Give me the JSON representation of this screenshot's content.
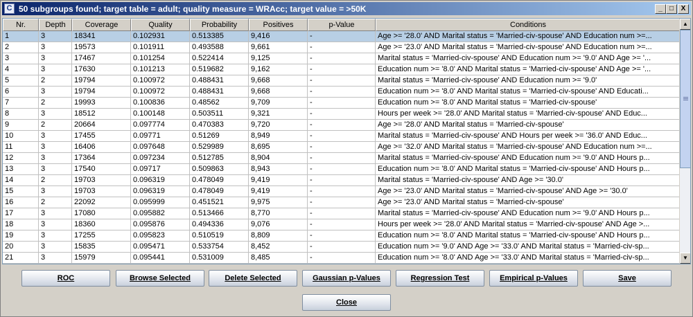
{
  "window": {
    "title": "50 subgroups found;  target table = adult;  quality measure = WRAcc;  target value = >50K",
    "icon_letter": "C",
    "minimize_label": "_",
    "maximize_label": "□",
    "close_label": "X"
  },
  "table": {
    "columns": [
      "Nr.",
      "Depth",
      "Coverage",
      "Quality",
      "Probability",
      "Positives",
      "p-Value",
      "Conditions"
    ],
    "rows": [
      [
        "1",
        "3",
        "18341",
        "0.102931",
        "0.513385",
        "9,416",
        "-",
        "Age >= '28.0' AND Marital status = 'Married-civ-spouse' AND Education num >=..."
      ],
      [
        "2",
        "3",
        "19573",
        "0.101911",
        "0.493588",
        "9,661",
        "-",
        "Age >= '23.0' AND Marital status = 'Married-civ-spouse' AND Education num >=..."
      ],
      [
        "3",
        "3",
        "17467",
        "0.101254",
        "0.522414",
        "9,125",
        "-",
        "Marital status = 'Married-civ-spouse' AND Education num >= '9.0' AND Age >= '..."
      ],
      [
        "4",
        "3",
        "17630",
        "0.101213",
        "0.519682",
        "9,162",
        "-",
        "Education num >= '8.0' AND Marital status = 'Married-civ-spouse' AND Age >= '..."
      ],
      [
        "5",
        "2",
        "19794",
        "0.100972",
        "0.488431",
        "9,668",
        "-",
        "Marital status = 'Married-civ-spouse' AND Education num >= '9.0'"
      ],
      [
        "6",
        "3",
        "19794",
        "0.100972",
        "0.488431",
        "9,668",
        "-",
        "Education num >= '8.0' AND Marital status = 'Married-civ-spouse' AND Educati..."
      ],
      [
        "7",
        "2",
        "19993",
        "0.100836",
        "0.48562",
        "9,709",
        "-",
        "Education num >= '8.0' AND Marital status = 'Married-civ-spouse'"
      ],
      [
        "8",
        "3",
        "18512",
        "0.100148",
        "0.503511",
        "9,321",
        "-",
        "Hours per week >= '28.0' AND Marital status = 'Married-civ-spouse' AND Educ..."
      ],
      [
        "9",
        "2",
        "20664",
        "0.097774",
        "0.470383",
        "9,720",
        "-",
        "Age >= '28.0' AND Marital status = 'Married-civ-spouse'"
      ],
      [
        "10",
        "3",
        "17455",
        "0.09771",
        "0.51269",
        "8,949",
        "-",
        "Marital status = 'Married-civ-spouse' AND Hours per week >= '36.0' AND Educ..."
      ],
      [
        "11",
        "3",
        "16406",
        "0.097648",
        "0.529989",
        "8,695",
        "-",
        "Age >= '32.0' AND Marital status = 'Married-civ-spouse' AND Education num >=..."
      ],
      [
        "12",
        "3",
        "17364",
        "0.097234",
        "0.512785",
        "8,904",
        "-",
        "Marital status = 'Married-civ-spouse' AND Education num >= '9.0' AND Hours p..."
      ],
      [
        "13",
        "3",
        "17540",
        "0.09717",
        "0.509863",
        "8,943",
        "-",
        "Education num >= '8.0' AND Marital status = 'Married-civ-spouse' AND Hours p..."
      ],
      [
        "14",
        "2",
        "19703",
        "0.096319",
        "0.478049",
        "9,419",
        "-",
        "Marital status = 'Married-civ-spouse' AND Age >= '30.0'"
      ],
      [
        "15",
        "3",
        "19703",
        "0.096319",
        "0.478049",
        "9,419",
        "-",
        "Age >= '23.0' AND Marital status = 'Married-civ-spouse' AND Age >= '30.0'"
      ],
      [
        "16",
        "2",
        "22092",
        "0.095999",
        "0.451521",
        "9,975",
        "-",
        "Age >= '23.0' AND Marital status = 'Married-civ-spouse'"
      ],
      [
        "17",
        "3",
        "17080",
        "0.095882",
        "0.513466",
        "8,770",
        "-",
        "Marital status = 'Married-civ-spouse' AND Education num >= '9.0' AND Hours p..."
      ],
      [
        "18",
        "3",
        "18360",
        "0.095876",
        "0.494336",
        "9,076",
        "-",
        "Hours per week >= '28.0' AND Marital status = 'Married-civ-spouse' AND Age >..."
      ],
      [
        "19",
        "3",
        "17255",
        "0.095823",
        "0.510519",
        "8,809",
        "-",
        "Education num >= '8.0' AND Marital status = 'Married-civ-spouse' AND Hours p..."
      ],
      [
        "20",
        "3",
        "15835",
        "0.095471",
        "0.533754",
        "8,452",
        "-",
        "Education num >= '9.0' AND Age >= '33.0' AND Marital status = 'Married-civ-sp..."
      ],
      [
        "21",
        "3",
        "15979",
        "0.095441",
        "0.531009",
        "8,485",
        "-",
        "Education num >= '8.0' AND Age >= '33.0' AND Marital status = 'Married-civ-sp..."
      ]
    ],
    "selected_row": 1
  },
  "buttons": {
    "roc": "ROC",
    "browse_selected": "Browse Selected",
    "delete_selected": "Delete Selected",
    "gaussian": "Gaussian p-Values",
    "regression": "Regression Test",
    "empirical": "Empirical p-Values",
    "save": "Save",
    "close": "Close"
  },
  "colors": {
    "selected_row": "#b8cfe5",
    "titlebar": "#0a246a"
  }
}
